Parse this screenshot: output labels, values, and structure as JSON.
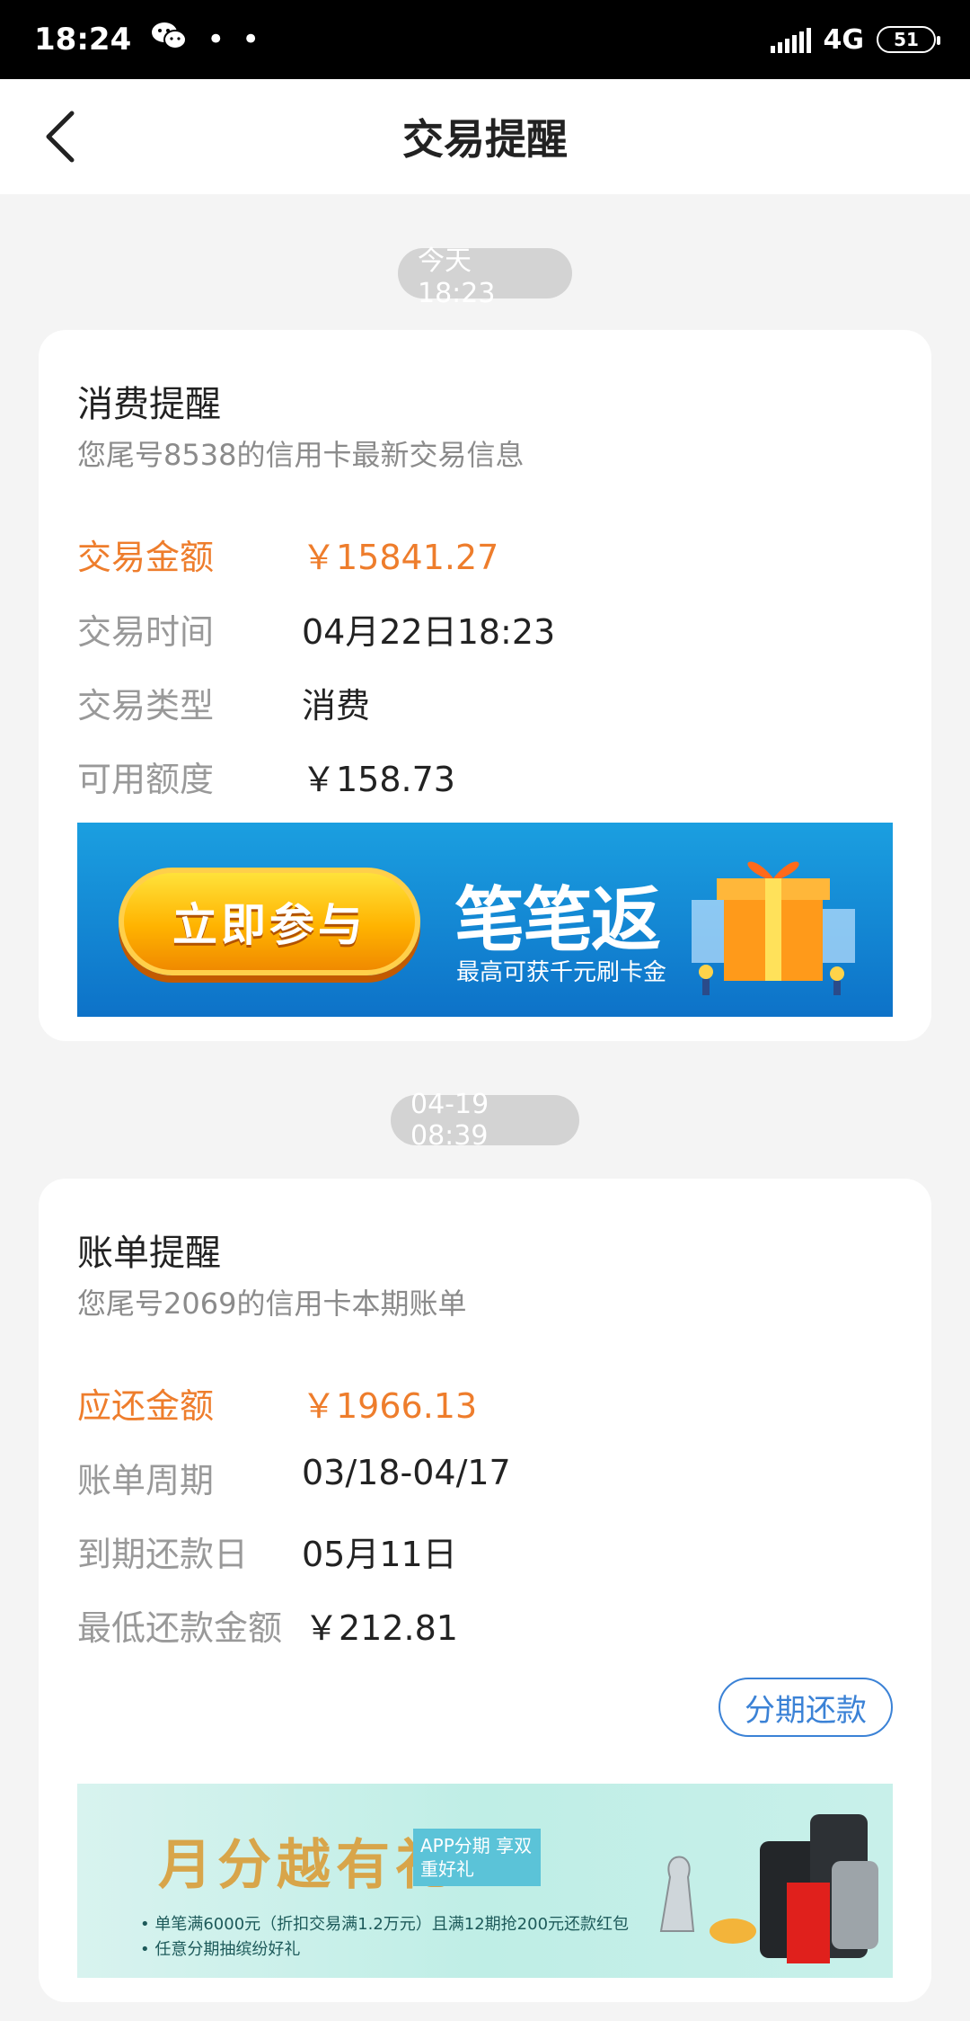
{
  "status_bar": {
    "time": "18:24",
    "dots": "• •",
    "network": "4G",
    "battery": "51"
  },
  "header": {
    "title": "交易提醒"
  },
  "messages": [
    {
      "time": "今天 18:23",
      "title": "消费提醒",
      "subtitle": "您尾号8538的信用卡最新交易信息",
      "rows": [
        {
          "label": "交易金额",
          "value": "￥15841.27"
        },
        {
          "label": "交易时间",
          "value": "04月22日18:23"
        },
        {
          "label": "交易类型",
          "value": "消费"
        },
        {
          "label": "可用额度",
          "value": "￥158.73"
        }
      ],
      "banner": {
        "button": "立即参与",
        "title": "笔笔返",
        "subtitle": "最高可获千元刷卡金"
      }
    },
    {
      "time": "04-19 08:39",
      "title": "账单提醒",
      "subtitle": "您尾号2069的信用卡本期账单",
      "rows": [
        {
          "label": "应还金额",
          "value": "￥1966.13"
        },
        {
          "label": "账单周期",
          "value": "03/18-04/17"
        },
        {
          "label": "到期还款日",
          "value": "05月11日"
        },
        {
          "label": "最低还款金额",
          "value": "￥212.81"
        }
      ],
      "action": "分期还款",
      "banner": {
        "title": "月分越有礼",
        "badge": "APP分期 享双重好礼",
        "note1": "• 单笔满6000元（折扣交易满1.2万元）且满12期抢200元还款红包",
        "note2": "• 任意分期抽缤纷好礼"
      }
    }
  ],
  "colors": {
    "accent": "#ee7d2c",
    "link": "#3b82d6"
  }
}
